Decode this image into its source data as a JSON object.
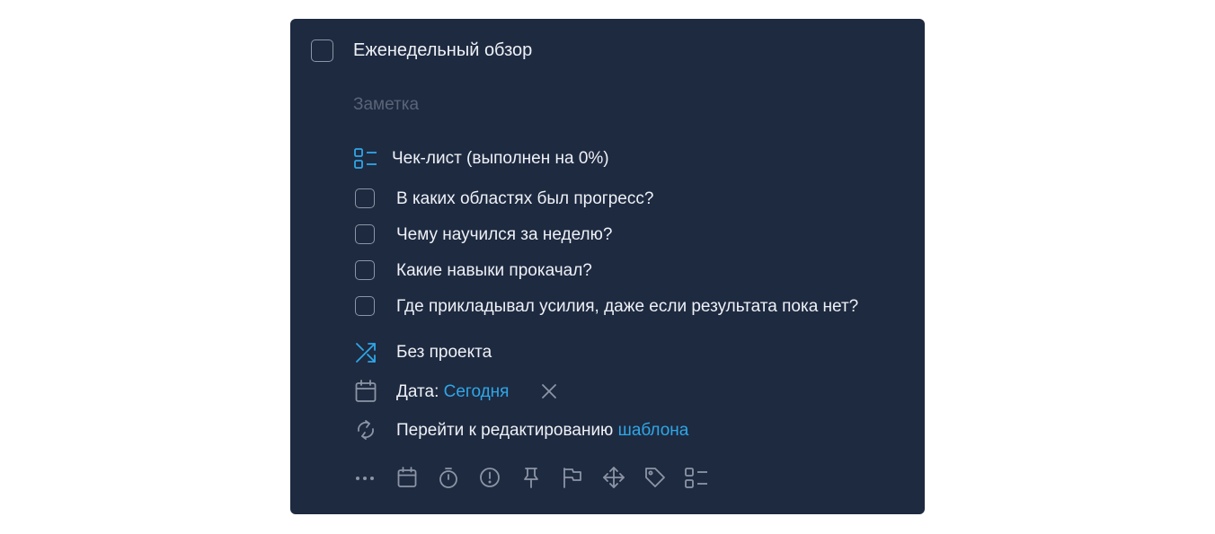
{
  "task": {
    "title": "Еженедельный обзор",
    "note_placeholder": "Заметка"
  },
  "checklist": {
    "header": "Чек-лист (выполнен на 0%)",
    "progress_percent": 0,
    "items": [
      {
        "label": "В каких областях был прогресс?",
        "checked": false
      },
      {
        "label": "Чему научился за неделю?",
        "checked": false
      },
      {
        "label": "Какие навыки прокачал?",
        "checked": false
      },
      {
        "label": "Где прикладывал усилия, даже если результата пока нет?",
        "checked": false
      }
    ]
  },
  "project": {
    "label": "Без проекта"
  },
  "date": {
    "label": "Дата:",
    "value": "Сегодня"
  },
  "template": {
    "label": "Перейти к редактированию",
    "link": "шаблона"
  },
  "toolbar": {
    "icons": [
      "more-icon",
      "calendar-icon",
      "timer-icon",
      "priority-icon",
      "pin-icon",
      "flag-icon",
      "move-icon",
      "tag-icon",
      "checklist-icon"
    ]
  },
  "colors": {
    "card_bg": "#1e2a40",
    "accent": "#2fa7e8",
    "text": "#eef1f6",
    "icon_gray": "#8c95a6"
  }
}
